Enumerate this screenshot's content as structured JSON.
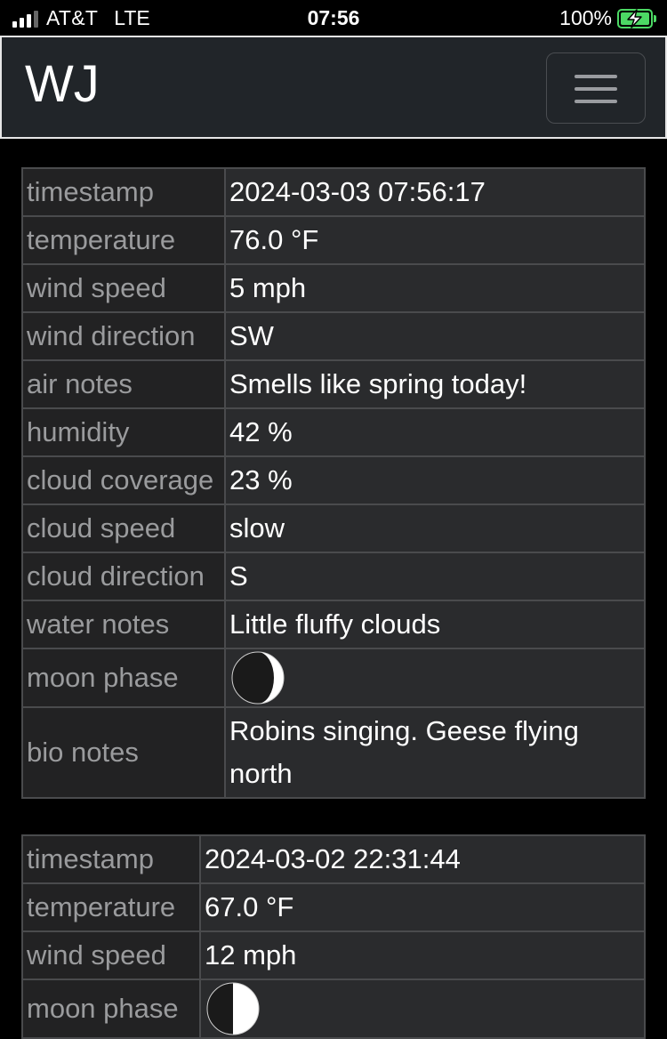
{
  "status_bar": {
    "carrier": "AT&T",
    "network": "LTE",
    "time": "07:56",
    "battery": "100%",
    "battery_color": "#4cd964"
  },
  "navbar": {
    "brand": "WJ",
    "menu_icon": "hamburger-icon"
  },
  "entries": [
    {
      "rows": [
        {
          "label": "timestamp",
          "value": "2024-03-03 07:56:17"
        },
        {
          "label": "temperature",
          "value": "76.0 °F"
        },
        {
          "label": "wind speed",
          "value": "5 mph"
        },
        {
          "label": "wind direction",
          "value": "SW"
        },
        {
          "label": "air notes",
          "value": "Smells like spring today!"
        },
        {
          "label": "humidity",
          "value": "42 %"
        },
        {
          "label": "cloud coverage",
          "value": "23 %"
        },
        {
          "label": "cloud speed",
          "value": "slow"
        },
        {
          "label": "cloud direction",
          "value": "S"
        },
        {
          "label": "water notes",
          "value": "Little fluffy clouds"
        },
        {
          "label": "moon phase",
          "icon": "waxing-crescent-moon-icon"
        },
        {
          "label": "bio notes",
          "value": "Robins singing. Geese flying north"
        }
      ]
    },
    {
      "rows": [
        {
          "label": "timestamp",
          "value": "2024-03-02 22:31:44"
        },
        {
          "label": "temperature",
          "value": "67.0 °F"
        },
        {
          "label": "wind speed",
          "value": "12 mph"
        },
        {
          "label": "moon phase",
          "icon": "first-quarter-moon-icon"
        }
      ]
    }
  ]
}
